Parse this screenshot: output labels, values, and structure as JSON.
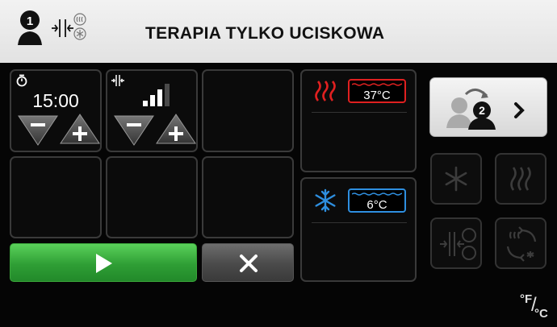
{
  "header": {
    "title": "TERAPIA TYLKO UCISKOWA",
    "patient_number": "1",
    "icons": [
      "person-icon",
      "compression-icon",
      "heat-icon",
      "snowflake-icon"
    ]
  },
  "timer": {
    "value": "15:00",
    "icon": "timer-icon"
  },
  "pressure": {
    "icon": "compression-icon",
    "level_fraction": 0.75
  },
  "heat": {
    "temperature": "37°C",
    "icon": "heat-waves-icon",
    "color": "#e02020"
  },
  "cold": {
    "temperature": "6°C",
    "icon": "snowflake-icon",
    "color": "#2e8fe0"
  },
  "patient_switch": {
    "patient_number": "2",
    "icon": "switch-patient-icon"
  },
  "modes": [
    "cold-mode-icon",
    "heat-mode-icon",
    "compression-cold-heat-icon",
    "contrast-cycle-icon"
  ],
  "units": {
    "degree_f": "°F",
    "slash": "/",
    "degree_c": "°C"
  },
  "actions": {
    "play_icon": "play-icon",
    "cancel_icon": "close-icon"
  },
  "colors": {
    "play_green": "#2f9e35",
    "header_bg": "#eaeaea"
  }
}
